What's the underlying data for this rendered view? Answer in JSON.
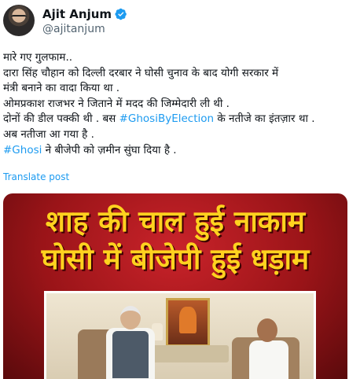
{
  "author": {
    "display_name": "Ajit Anjum",
    "handle": "@ajitanjum",
    "verified": true,
    "avatar_icon": "profile-photo"
  },
  "tweet": {
    "lines": [
      [
        {
          "text": "मारे गए गुलफाम..",
          "type": "text"
        }
      ],
      [
        {
          "text": "दारा सिंह चौहान को दिल्ली दरबार ने घोसी चुनाव के बाद योगी सरकार में",
          "type": "text"
        }
      ],
      [
        {
          "text": "मंत्री बनाने का वादा किया था .",
          "type": "text"
        }
      ],
      [
        {
          "text": "ओमप्रकाश राजभर ने जिताने में मदद की जिम्मेदारी ली थी .",
          "type": "text"
        }
      ],
      [
        {
          "text": "दोनों की डील पक्की थी . बस ",
          "type": "text"
        },
        {
          "text": "#GhosiByElection",
          "type": "hashtag"
        },
        {
          "text": " के नतीजे का इंतज़ार था .",
          "type": "text"
        }
      ],
      [
        {
          "text": "अब नतीजा आ गया है .",
          "type": "text"
        }
      ],
      [
        {
          "text": "#Ghosi",
          "type": "hashtag"
        },
        {
          "text": " ने बीजेपी को ज़मीन सुंघा दिया है .",
          "type": "text"
        }
      ]
    ],
    "translate_label": "Translate post"
  },
  "media": {
    "headline_line1": "शाह की चाल हुई नाकाम",
    "headline_line2": "घोसी में बीजेपी हुई धड़ाम"
  },
  "colors": {
    "text": "#0f1419",
    "secondary": "#536471",
    "link": "#1d9bf0",
    "headline": "#ffd21f",
    "banner": "#b01c22"
  }
}
